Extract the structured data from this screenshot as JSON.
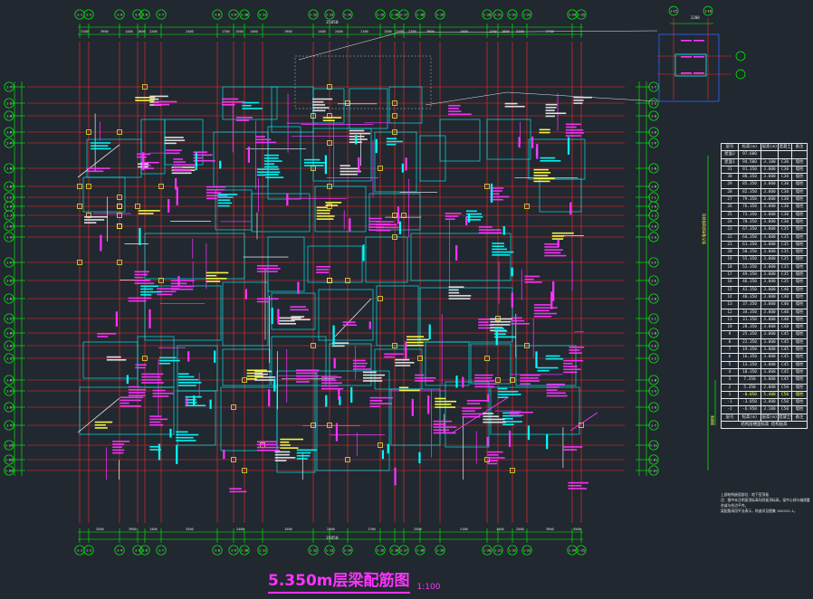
{
  "drawing": {
    "title": "5.350m层梁配筋图",
    "scale": "1:100"
  },
  "dims": {
    "top_total": "35850",
    "bottom_total": "35850",
    "top_segments": [
      "3100",
      "3900",
      "1400",
      "1800",
      "2200",
      "2400",
      "1700",
      "1500",
      "1400",
      "1900",
      "1400",
      "2400",
      "1100",
      "1500",
      "3100",
      "2700",
      "3900",
      "1400",
      "1200",
      "1800",
      "3100",
      "2700"
    ],
    "bottom_segments": [
      "3500",
      "3900",
      "1400",
      "2500",
      "2400",
      "1500",
      "2300",
      "1700",
      "2500",
      "2100",
      "1400",
      "2500",
      "3900",
      "3500"
    ]
  },
  "floor_table": {
    "header": [
      "层号",
      "标高(m)",
      "层高(m)",
      "混凝土",
      "备注"
    ],
    "rows": [
      [
        "屋面2",
        "97.600",
        "",
        "",
        ""
      ],
      [
        "屋面1",
        "94.500",
        "3.100",
        "C30",
        "墙柱"
      ],
      [
        "31",
        "91.350",
        "3.000",
        "C30",
        "墙柱"
      ],
      [
        "30",
        "88.350",
        "3.000",
        "C30",
        "墙柱"
      ],
      [
        "29",
        "85.350",
        "3.000",
        "C30",
        "墙柱"
      ],
      [
        "28",
        "82.350",
        "3.000",
        "C30",
        "墙柱"
      ],
      [
        "27",
        "79.350",
        "3.000",
        "C30",
        "墙柱"
      ],
      [
        "26",
        "76.350",
        "3.000",
        "C30",
        "墙柱"
      ],
      [
        "25",
        "73.350",
        "3.000",
        "C30",
        "墙柱"
      ],
      [
        "24",
        "70.350",
        "3.000",
        "C30",
        "墙柱"
      ],
      [
        "23",
        "67.350",
        "3.000",
        "C35",
        "墙柱"
      ],
      [
        "22",
        "64.350",
        "3.000",
        "C35",
        "墙柱"
      ],
      [
        "21",
        "61.350",
        "3.000",
        "C35",
        "墙柱"
      ],
      [
        "20",
        "58.350",
        "3.000",
        "C35",
        "墙柱"
      ],
      [
        "19",
        "55.350",
        "3.000",
        "C35",
        "墙柱"
      ],
      [
        "18",
        "52.350",
        "3.000",
        "C35",
        "墙柱"
      ],
      [
        "17",
        "49.350",
        "3.000",
        "C35",
        "墙柱"
      ],
      [
        "16",
        "46.350",
        "3.000",
        "C35",
        "墙柱"
      ],
      [
        "15",
        "43.350",
        "3.000",
        "C40",
        "墙柱"
      ],
      [
        "14",
        "40.350",
        "3.000",
        "C40",
        "墙柱"
      ],
      [
        "13",
        "37.350",
        "3.000",
        "C40",
        "墙柱"
      ],
      [
        "12",
        "34.350",
        "3.000",
        "C40",
        "墙柱"
      ],
      [
        "11",
        "31.350",
        "3.000",
        "C40",
        "墙柱"
      ],
      [
        "10",
        "28.350",
        "3.000",
        "C40",
        "墙柱"
      ],
      [
        "9",
        "25.350",
        "3.000",
        "C45",
        "墙柱"
      ],
      [
        "8",
        "22.350",
        "3.000",
        "C45",
        "墙柱"
      ],
      [
        "7",
        "19.350",
        "3.000",
        "C45",
        "墙柱"
      ],
      [
        "6",
        "16.350",
        "3.000",
        "C45",
        "墙柱"
      ],
      [
        "5",
        "13.350",
        "3.000",
        "C45",
        "墙柱"
      ],
      [
        "4",
        "10.350",
        "3.000",
        "C45",
        "墙柱"
      ],
      [
        "3",
        "7.350",
        "3.000",
        "C45",
        "墙柱"
      ],
      [
        "2",
        "5.350",
        "2.000",
        "C50",
        "墙柱"
      ],
      [
        "1",
        "-0.050",
        "5.400",
        "C50",
        "墙柱"
      ],
      [
        "-1",
        "-3.850",
        "3.800",
        "C50",
        "墙柱"
      ],
      [
        "-2",
        "-6.950",
        "3.100",
        "C50",
        "墙柱"
      ]
    ],
    "highlight_row": 32,
    "side_label": "剪力墙底部加强部位",
    "side_label2": "嵌固端",
    "foot_row": [
      "层号",
      "标高(m)",
      "层高(m)",
      "混凝土强度",
      "备注"
    ],
    "foot_row2": "结构层楼面标高 结构层高"
  },
  "notes": [
    "上部结构嵌固部位：地下室顶板",
    "注：图中未注明梁顶标高均同板顶标高，梁中心线与轴线重合或与柱边平齐。",
    "梁配筋采用平法表示，构造详见图集 16G101-1。"
  ],
  "inset": {
    "dim": "2200",
    "labels": [
      "1-15",
      "1-16"
    ]
  },
  "colors": {
    "background": "#212830",
    "grid_axis": "#ff2a2a",
    "dimension": "#00ff00",
    "beam": "#ff33ff",
    "wall": "#00ffff",
    "text_yellow": "#ffff44",
    "text_white": "#e8e8e8"
  }
}
